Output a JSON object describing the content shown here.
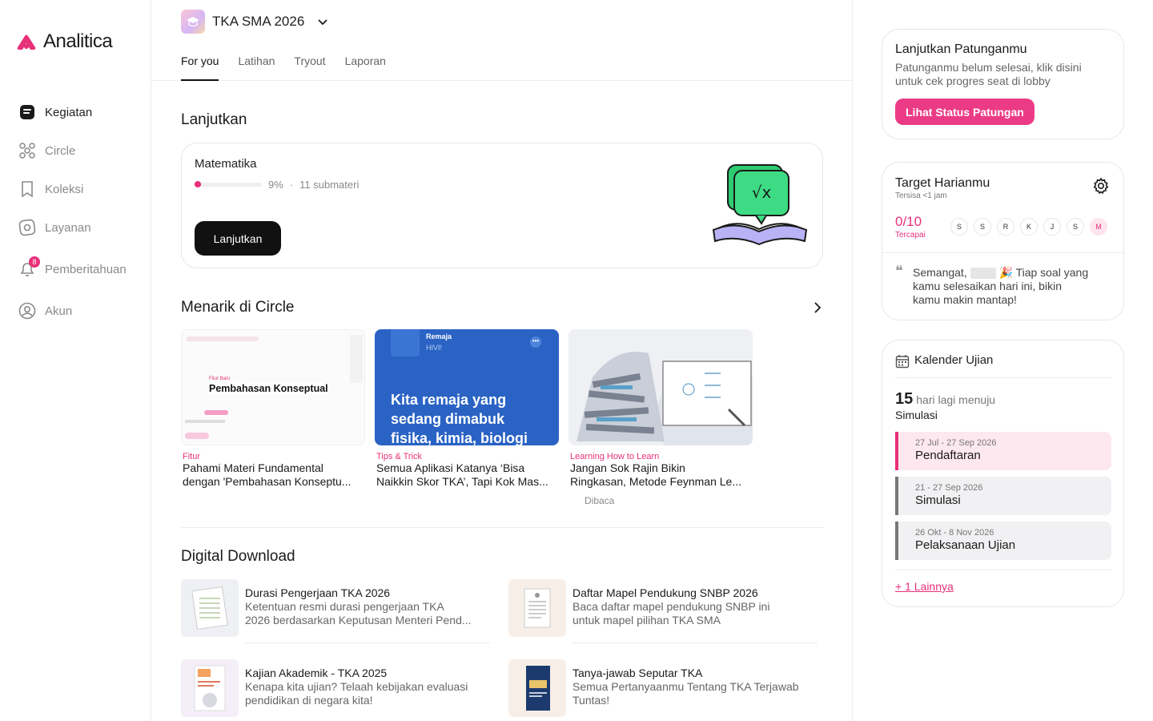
{
  "brand": {
    "name": "Analitica",
    "color": "#e8307a"
  },
  "sidebar": {
    "items": [
      {
        "label": "Kegiatan",
        "icon": "activity-icon",
        "active": true
      },
      {
        "label": "Circle",
        "icon": "circle-community-icon"
      },
      {
        "label": "Koleksi",
        "icon": "bookmark-icon"
      },
      {
        "label": "Layanan",
        "icon": "service-icon"
      },
      {
        "label": "Pemberitahuan",
        "icon": "bell-icon",
        "badge": "8"
      },
      {
        "label": "Akun",
        "icon": "user-icon"
      }
    ]
  },
  "header": {
    "program": "TKA SMA 2026",
    "tabs": [
      "For you",
      "Latihan",
      "Tryout",
      "Laporan"
    ]
  },
  "continue": {
    "title": "Lanjutkan",
    "subject": "Matematika",
    "percent": "9%",
    "progress": 0.09,
    "submateri": "11 submateri",
    "button": "Lanjutkan"
  },
  "circle": {
    "title": "Menarik di Circle",
    "cards": [
      {
        "tag": "Fitur",
        "title_line1": "Pahami Materi Fundamental",
        "title_line2": "dengan 'Pembahasan Konseptu...",
        "image_text": "Pembahasan Konseptual",
        "image_small": "Fitur Baru"
      },
      {
        "tag": "Tips & Trick",
        "title_line1": "Semua Aplikasi Katanya ‘Bisa",
        "title_line2": "Naikkin Skor TKA’, Tapi Kok Mas...",
        "image_text": "Kita remaja yang sedang dimabuk fisika, kimia, biologi",
        "image_small": "Remaja",
        "image_small2": "HIVI!"
      },
      {
        "tag": "Learning How to Learn",
        "title_line1": "Jangan Sok Rajin Bikin",
        "title_line2": "Ringkasan, Metode Feynman Le...",
        "meta": "Dibaca"
      }
    ]
  },
  "downloads": {
    "title": "Digital Download",
    "items": [
      {
        "title": "Durasi Pengerjaan TKA 2026",
        "desc1": "Ketentuan resmi durasi pengerjaan TKA",
        "desc2": "2026 berdasarkan Keputusan Menteri Pend..."
      },
      {
        "title": "Daftar Mapel Pendukung SNBP 2026",
        "desc1": "Baca daftar mapel pendukung SNBP ini",
        "desc2": "untuk mapel pilihan TKA SMA"
      },
      {
        "title": "Kajian Akademik - TKA 2025",
        "desc1": "Kenapa kita ujian? Telaah kebijakan evaluasi",
        "desc2": "pendidikan di negara kita!"
      },
      {
        "title": "Tanya-jawab Seputar TKA",
        "desc1": "Semua Pertanyaanmu Tentang TKA Terjawab",
        "desc2": "Tuntas!"
      }
    ]
  },
  "patungan": {
    "title": "Lanjutkan Patunganmu",
    "desc1": "Patunganmu belum selesai, klik disini",
    "desc2": "untuk cek progres seat di lobby",
    "button": "Lihat Status Patungan"
  },
  "target": {
    "title": "Target Harianmu",
    "remaining": "Tersisa <1 jam",
    "value": "0/10",
    "value_label": "Tercapai",
    "days": [
      "S",
      "S",
      "R",
      "K",
      "J",
      "S",
      "M"
    ],
    "quote_start": "Semangat,",
    "quote_emoji": "🎉",
    "quote1": "Tiap soal yang",
    "quote2": "kamu selesaikan hari ini, bikin",
    "quote3": "kamu makin mantap!"
  },
  "calendar": {
    "title": "Kalender Ujian",
    "days_count": "15",
    "days_text": "hari lagi menuju",
    "target_event": "Simulasi",
    "phases": [
      {
        "date": "27 Jul - 27 Sep 2026",
        "name": "Pendaftaran",
        "active": true
      },
      {
        "date": "21 - 27 Sep 2026",
        "name": "Simulasi"
      },
      {
        "date": "26 Okt - 8 Nov 2026",
        "name": "Pelaksanaan Ujian"
      }
    ],
    "more": "+ 1 Lainnya"
  }
}
